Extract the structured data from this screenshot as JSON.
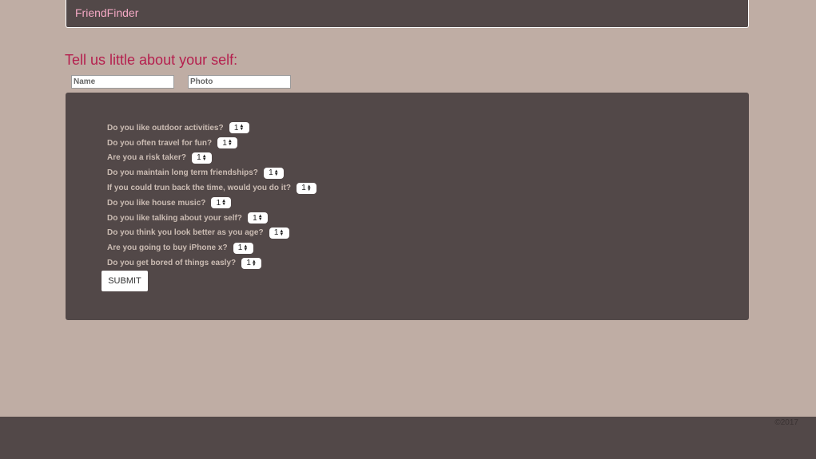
{
  "navbar": {
    "brand": "FriendFinder"
  },
  "form": {
    "heading": "Tell us little about your self:",
    "name_placeholder": "Name",
    "photo_placeholder": "Photo"
  },
  "survey": {
    "questions": [
      {
        "label": "Do you like outdoor activities?",
        "value": "1"
      },
      {
        "label": "Do you often travel for fun?",
        "value": "1"
      },
      {
        "label": "Are you a risk taker?",
        "value": "1"
      },
      {
        "label": "Do you maintain long term friendships?",
        "value": "1"
      },
      {
        "label": "If you could trun back the time, would you do it?",
        "value": "1"
      },
      {
        "label": "Do you like house music?",
        "value": "1"
      },
      {
        "label": "Do you like talking about your self?",
        "value": "1"
      },
      {
        "label": "Do you think you look better as you age?",
        "value": "1"
      },
      {
        "label": "Are you going to buy iPhone x?",
        "value": "1"
      },
      {
        "label": "Do you get bored of things easly?",
        "value": "1"
      }
    ],
    "submit_label": "SUBMIT"
  },
  "footer": {
    "copyright": "©2017"
  },
  "colors": {
    "background": "#bfada4",
    "panel": "#524848",
    "brand": "#f5a9c5",
    "heading": "#b5204e"
  },
  "icons": {
    "select_arrows": "updown-arrows-icon"
  }
}
